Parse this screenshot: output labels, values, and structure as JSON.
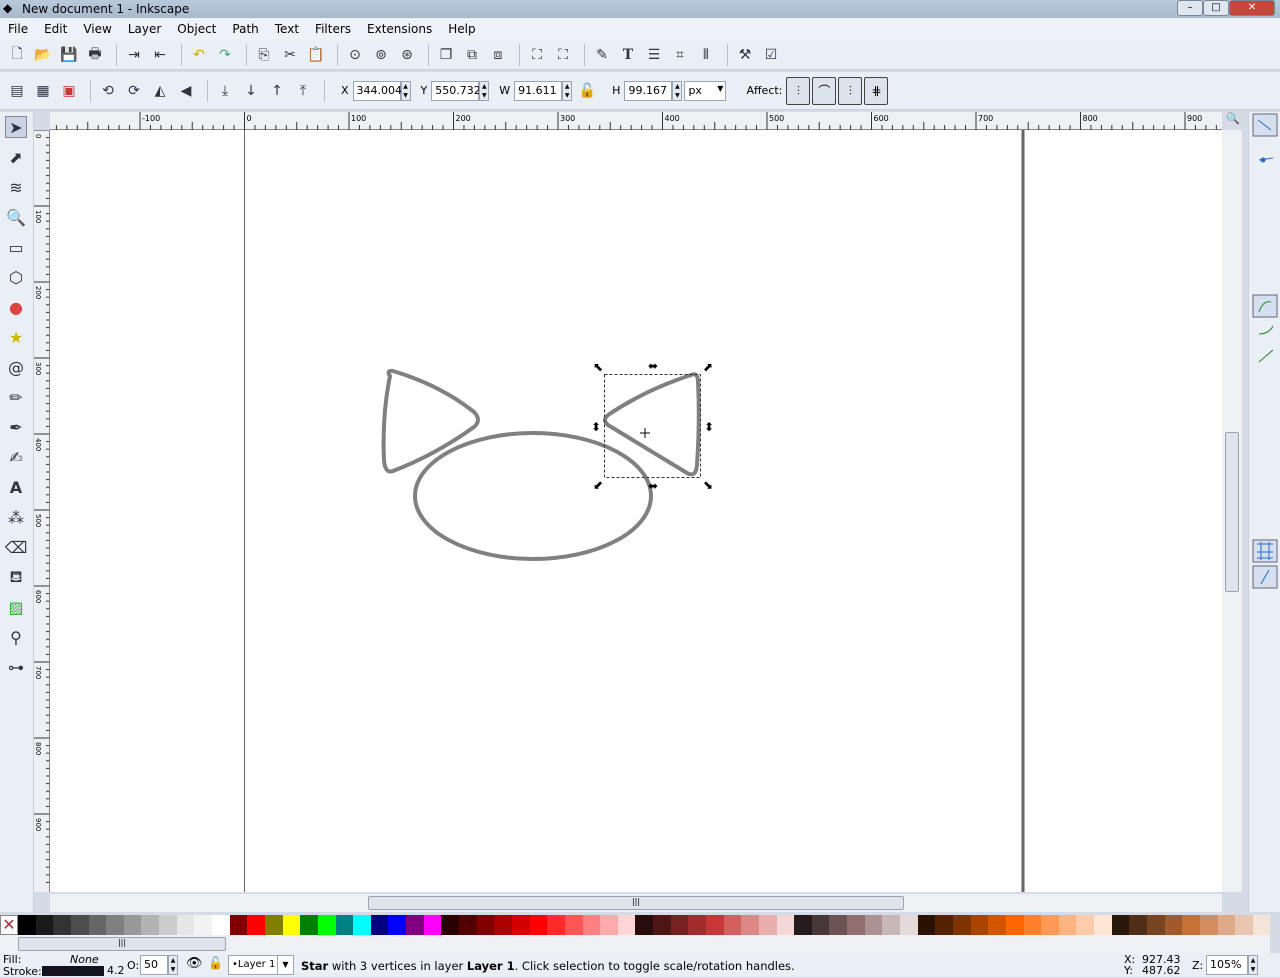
{
  "window": {
    "title": "New document 1 - Inkscape"
  },
  "menu": [
    "File",
    "Edit",
    "View",
    "Layer",
    "Object",
    "Path",
    "Text",
    "Filters",
    "Extensions",
    "Help"
  ],
  "tool_controls": {
    "x_label": "X",
    "x": "344.004",
    "y_label": "Y",
    "y": "550.732",
    "w_label": "W",
    "w": "91.611",
    "h_label": "H",
    "h": "99.167",
    "unit": "px",
    "affect_label": "Affect:"
  },
  "ruler_h": [
    "-100",
    "0",
    "100",
    "200",
    "300",
    "400",
    "500",
    "600",
    "700",
    "800",
    "900"
  ],
  "ruler_v": [
    "0",
    "100",
    "200",
    "300",
    "400",
    "500",
    "600",
    "700",
    "800",
    "900"
  ],
  "status": {
    "fill_label": "Fill:",
    "fill_value": "None",
    "stroke_label": "Stroke:",
    "stroke_width": "4.2",
    "opacity_label": "O:",
    "opacity": "50",
    "layer": "•Layer 1",
    "message_bold": "Star",
    "message_rest": " with 3 vertices in layer ",
    "message_layer": "Layer 1",
    "message_end": ". Click selection to toggle scale/rotation handles.",
    "x_label": "X:",
    "x": "927.43",
    "y_label": "Y:",
    "y": "487.62",
    "zoom_label": "Z:",
    "zoom": "105%"
  },
  "colors": {
    "stroke": "#808080",
    "stroke_indicator": "#14121e"
  },
  "palette": [
    "#000000",
    "#1a1a1a",
    "#333333",
    "#4d4d4d",
    "#666666",
    "#808080",
    "#999999",
    "#b3b3b3",
    "#cccccc",
    "#e6e6e6",
    "#f2f2f2",
    "#ffffff",
    "#800000",
    "#ff0000",
    "#808000",
    "#ffff00",
    "#008000",
    "#00ff00",
    "#008080",
    "#00ffff",
    "#000080",
    "#0000ff",
    "#800080",
    "#ff00ff",
    "#2b0000",
    "#550000",
    "#800000",
    "#aa0000",
    "#d40000",
    "#ff0000",
    "#ff2a2a",
    "#ff5555",
    "#ff8080",
    "#ffaaaa",
    "#ffd5d5",
    "#280b0b",
    "#501616",
    "#782121",
    "#a02c2c",
    "#c83737",
    "#d35f5f",
    "#de8787",
    "#e9afaf",
    "#f4d7d7",
    "#241c1c",
    "#483737",
    "#6c5353",
    "#916f6f",
    "#ac9393",
    "#c8b7b7",
    "#e3dbdb",
    "#2b1100",
    "#552200",
    "#803300",
    "#aa4400",
    "#d45500",
    "#ff6600",
    "#ff7f2a",
    "#ff9955",
    "#ffb380",
    "#ffccaa",
    "#ffe6d5",
    "#28170b",
    "#502d16",
    "#784421",
    "#a05a2c",
    "#c87137",
    "#d38d5f",
    "#deaa87",
    "#e9c6af",
    "#f4e3d7"
  ]
}
